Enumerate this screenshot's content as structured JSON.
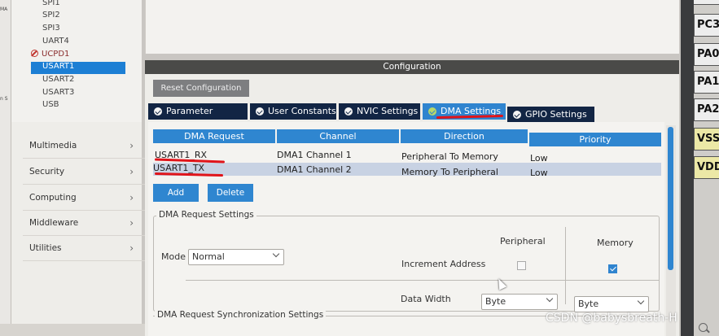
{
  "left_strip": {
    "labels": [
      "MA",
      "n S"
    ]
  },
  "peripherals": {
    "items": [
      {
        "label": "SPI1",
        "state": "normal"
      },
      {
        "label": "SPI2",
        "state": "normal"
      },
      {
        "label": "SPI3",
        "state": "normal"
      },
      {
        "label": "UART4",
        "state": "normal"
      },
      {
        "label": "UCPD1",
        "state": "disabled"
      },
      {
        "label": "USART1",
        "state": "selected"
      },
      {
        "label": "USART2",
        "state": "normal"
      },
      {
        "label": "USART3",
        "state": "normal"
      },
      {
        "label": "USB",
        "state": "normal"
      }
    ]
  },
  "categories": [
    {
      "label": "Multimedia"
    },
    {
      "label": "Security"
    },
    {
      "label": "Computing"
    },
    {
      "label": "Middleware"
    },
    {
      "label": "Utilities"
    }
  ],
  "config": {
    "title": "Configuration",
    "reset_label": "Reset Configuration",
    "tabs": [
      {
        "label": "Parameter Settings",
        "active": false
      },
      {
        "label": "User Constants",
        "active": false
      },
      {
        "label": "NVIC Settings",
        "active": false
      },
      {
        "label": "DMA Settings",
        "active": true
      },
      {
        "label": "GPIO Settings",
        "active": false
      }
    ],
    "dma_table": {
      "headers": [
        "DMA Request",
        "Channel",
        "Direction",
        "Priority"
      ],
      "rows": [
        {
          "request": "USART1_RX",
          "channel": "DMA1 Channel 1",
          "direction": "Peripheral To Memory",
          "priority": "Low",
          "selected": false
        },
        {
          "request": "USART1_TX",
          "channel": "DMA1 Channel 2",
          "direction": "Memory To Peripheral",
          "priority": "Low",
          "selected": true
        }
      ]
    },
    "add_label": "Add",
    "delete_label": "Delete",
    "request_settings": {
      "legend": "DMA Request Settings",
      "mode_label": "Mode",
      "mode_value": "Normal",
      "peripheral_header": "Peripheral",
      "memory_header": "Memory",
      "increment_label": "Increment Address",
      "peripheral_increment": false,
      "memory_increment": true,
      "data_width_label": "Data Width",
      "peripheral_width": "Byte",
      "memory_width": "Byte"
    },
    "sync_legend": "DMA Request Synchronization Settings"
  },
  "pins": [
    "PC3",
    "PA0",
    "PA1",
    "PA2",
    "VSS",
    "VDD"
  ],
  "watermark": "CSDN @babysbreath-H"
}
